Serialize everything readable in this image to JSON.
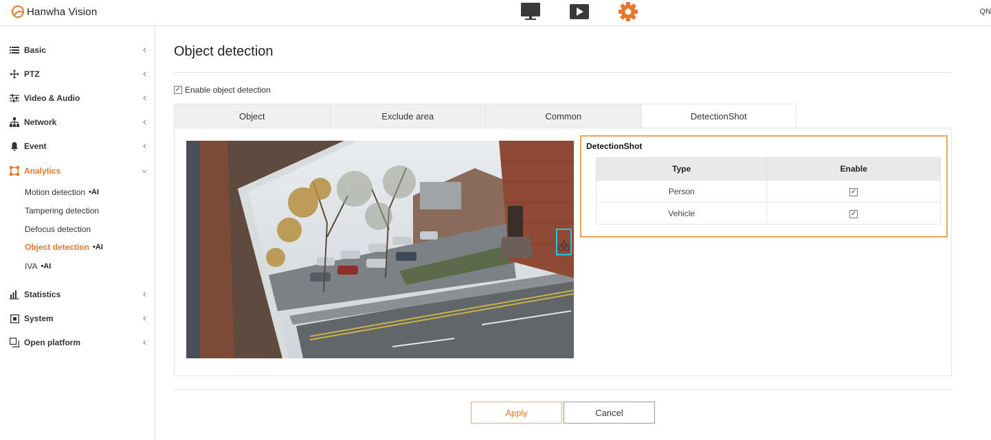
{
  "header": {
    "brand": "Hanwha Vision",
    "right_text": "QN",
    "icons": [
      "monitor-icon",
      "play-icon",
      "gear-icon"
    ],
    "accent": "#e8762d"
  },
  "sidebar": {
    "groups": [
      {
        "label": "Basic",
        "icon": "list-icon"
      },
      {
        "label": "PTZ",
        "icon": "move-icon"
      },
      {
        "label": "Video & Audio",
        "icon": "sliders-icon"
      },
      {
        "label": "Network",
        "icon": "network-icon"
      },
      {
        "label": "Event",
        "icon": "bell-icon"
      },
      {
        "label": "Analytics",
        "icon": "analytics-icon",
        "expanded": true
      },
      {
        "label": "Statistics",
        "icon": "bar-chart-icon"
      },
      {
        "label": "System",
        "icon": "system-icon"
      },
      {
        "label": "Open platform",
        "icon": "platform-icon"
      }
    ],
    "analytics_items": [
      {
        "label": "Motion detection",
        "badge": "•AI"
      },
      {
        "label": "Tampering detection"
      },
      {
        "label": "Defocus detection"
      },
      {
        "label": "Object detection",
        "badge": "•AI",
        "active": true
      },
      {
        "label": "IVA",
        "badge": "•AI"
      }
    ]
  },
  "main": {
    "title": "Object detection",
    "enable_label": "Enable object detection",
    "enable_checked": true,
    "tabs": [
      {
        "label": "Object"
      },
      {
        "label": "Exclude area"
      },
      {
        "label": "Common"
      },
      {
        "label": "DetectionShot",
        "active": true
      }
    ],
    "detectionshot": {
      "title": "DetectionShot",
      "headers": [
        "Type",
        "Enable"
      ],
      "rows": [
        {
          "type": "Person",
          "enabled": true
        },
        {
          "type": "Vehicle",
          "enabled": true
        }
      ]
    },
    "buttons": {
      "apply": "Apply",
      "cancel": "Cancel"
    }
  }
}
